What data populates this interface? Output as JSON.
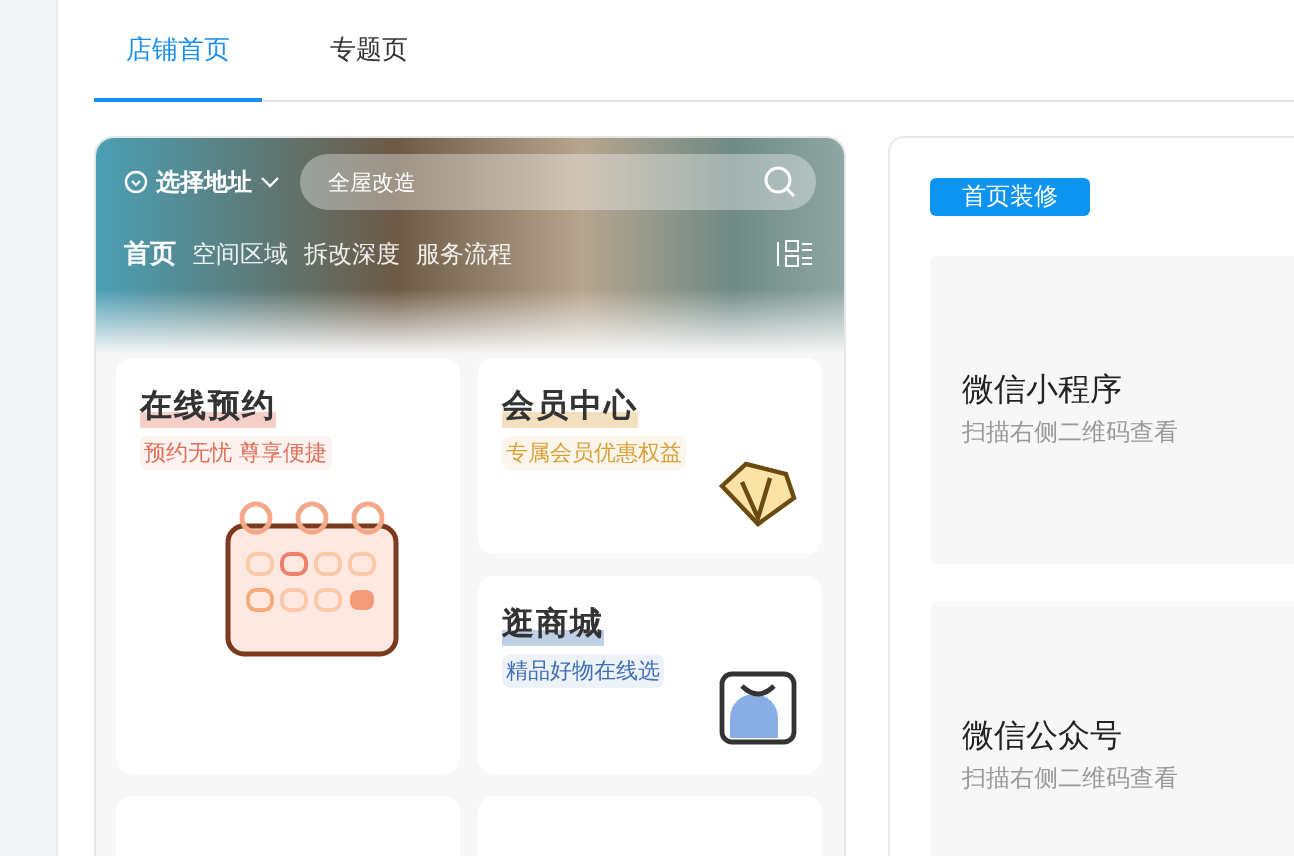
{
  "tabs": [
    {
      "label": "店铺首页",
      "selected": true
    },
    {
      "label": "专题页",
      "selected": false
    }
  ],
  "preview": {
    "location": "选择地址",
    "search": {
      "placeholder": "全屋改造"
    },
    "nav": [
      {
        "label": "首页",
        "selected": true
      },
      {
        "label": "空间区域",
        "selected": false
      },
      {
        "label": "拆改深度",
        "selected": false
      },
      {
        "label": "服务流程",
        "selected": false
      }
    ],
    "cards": [
      {
        "kind": "calendar",
        "title": "在线预约",
        "subtitle": "预约无忧 尊享便捷",
        "color": "#e0705a"
      },
      {
        "kind": "diamond",
        "title": "会员中心",
        "subtitle": "专属会员优惠权益",
        "color": "#d9a13a"
      },
      {
        "kind": "bag",
        "title": "逛商城",
        "subtitle": "精品好物在线选",
        "color": "#3d6fb5"
      }
    ]
  },
  "side": {
    "button": "首页装修",
    "channels": [
      {
        "title": "微信小程序",
        "hint": "扫描右侧二维码查看"
      },
      {
        "title": "微信公众号",
        "hint": "扫描右侧二维码查看"
      }
    ]
  }
}
